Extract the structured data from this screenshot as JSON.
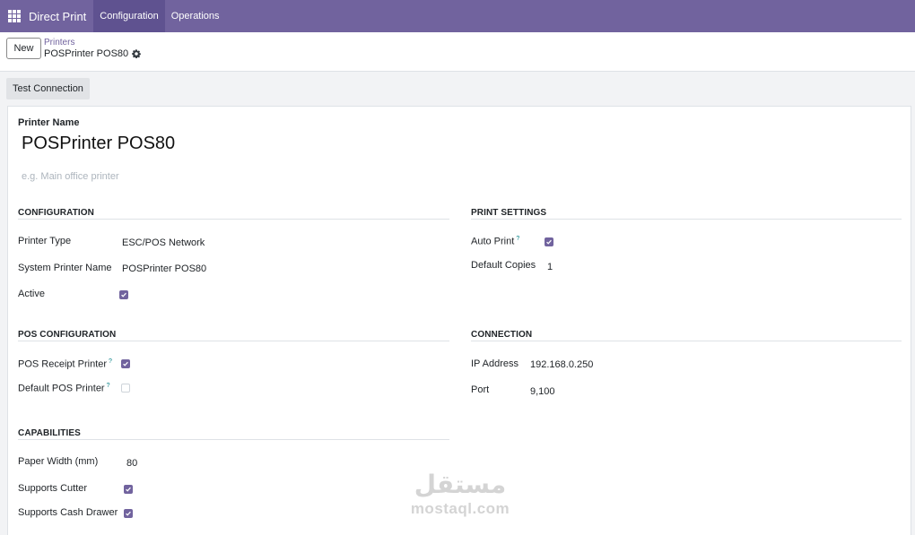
{
  "navbar": {
    "apps_icon": "apps-grid-icon",
    "brand": "Direct Print",
    "menu": [
      "Configuration",
      "Operations"
    ],
    "active_menu": "Configuration",
    "color": "#71639e"
  },
  "control": {
    "new_label": "New",
    "breadcrumb_parent": "Printers",
    "breadcrumb_current": "POSPrinter POS80",
    "settings_icon": "gear-icon"
  },
  "actions": {
    "test_connection": "Test Connection"
  },
  "form": {
    "printer_name_label": "Printer Name",
    "printer_name": "POSPrinter POS80",
    "description_placeholder": "e.g. Main office printer",
    "configuration": {
      "title": "CONFIGURATION",
      "printer_type_label": "Printer Type",
      "printer_type": "ESC/POS Network",
      "system_printer_name_label": "System Printer Name",
      "system_printer_name": "POSPrinter POS80",
      "active_label": "Active",
      "active": true
    },
    "print_settings": {
      "title": "PRINT SETTINGS",
      "auto_print_label": "Auto Print",
      "auto_print_help": "?",
      "auto_print": true,
      "default_copies_label": "Default Copies",
      "default_copies": "1"
    },
    "pos_configuration": {
      "title": "POS CONFIGURATION",
      "pos_receipt_printer_label": "POS Receipt Printer",
      "pos_receipt_printer_help": "?",
      "pos_receipt_printer": true,
      "default_pos_printer_label": "Default POS Printer",
      "default_pos_printer_help": "?",
      "default_pos_printer": false
    },
    "connection": {
      "title": "CONNECTION",
      "ip_address_label": "IP Address",
      "ip_address": "192.168.0.250",
      "port_label": "Port",
      "port": "9,100"
    },
    "capabilities": {
      "title": "CAPABILITIES",
      "paper_width_label": "Paper Width (mm)",
      "paper_width": "80",
      "supports_cutter_label": "Supports Cutter",
      "supports_cutter": true,
      "supports_cash_drawer_label": "Supports Cash Drawer",
      "supports_cash_drawer": true
    }
  },
  "watermark": {
    "arabic": "مستقل",
    "latin": "mostaql.com"
  }
}
